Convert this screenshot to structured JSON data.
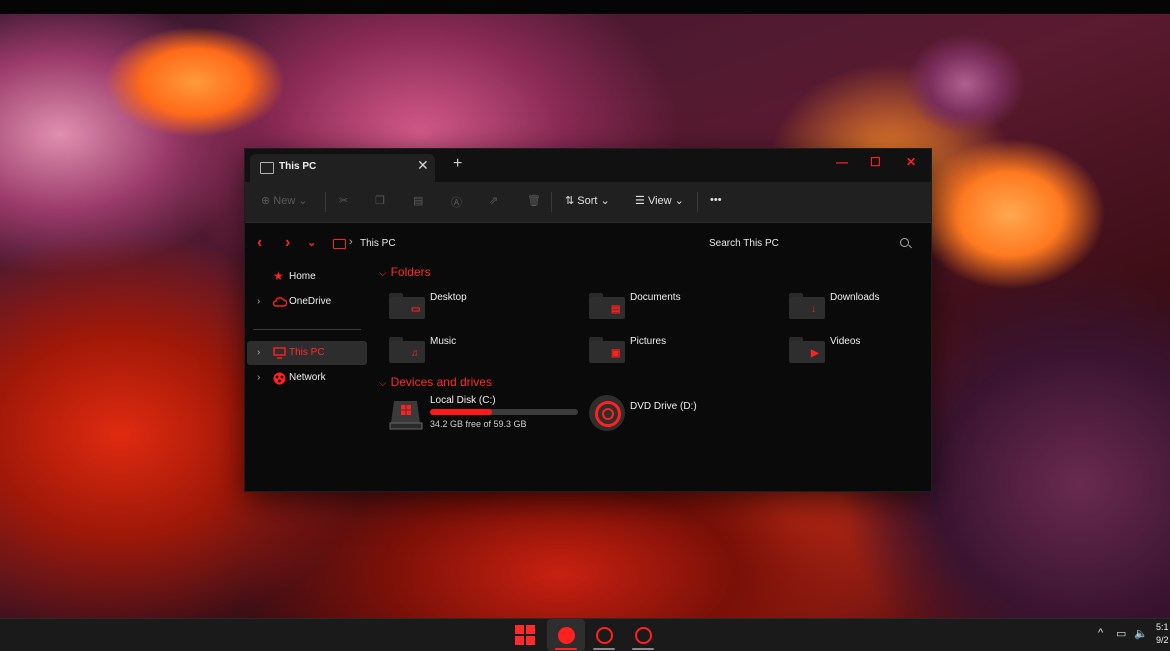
{
  "window": {
    "tab_title": "This PC",
    "tab_close": "✕",
    "new_tab": "+",
    "controls": {
      "minimize": "—",
      "maximize": "☐",
      "close": "✕"
    }
  },
  "toolbar": {
    "new_label": "New",
    "sort_label": "Sort",
    "view_label": "View",
    "more_label": "•••"
  },
  "address": {
    "back": "‹",
    "forward": "›",
    "recent": "⌄",
    "separator": "›",
    "breadcrumb": "This PC",
    "search_placeholder": "Search This PC"
  },
  "sidebar": {
    "items": [
      {
        "label": "Home",
        "icon": "home-star-icon"
      },
      {
        "label": "OneDrive",
        "icon": "cloud-icon"
      },
      {
        "label": "This PC",
        "icon": "monitor-icon",
        "selected": true
      },
      {
        "label": "Network",
        "icon": "network-icon"
      }
    ]
  },
  "content": {
    "folders_header": "Folders",
    "folders": [
      {
        "label": "Desktop",
        "glyph": "▭"
      },
      {
        "label": "Documents",
        "glyph": "▤"
      },
      {
        "label": "Downloads",
        "glyph": "↓"
      },
      {
        "label": "Music",
        "glyph": "♫"
      },
      {
        "label": "Pictures",
        "glyph": "▣"
      },
      {
        "label": "Videos",
        "glyph": "▶"
      }
    ],
    "drives_header": "Devices and drives",
    "drives": [
      {
        "name": "Local Disk (C:)",
        "free_text": "34.2 GB free of 59.3 GB",
        "used_fraction": 0.42
      },
      {
        "name": "DVD Drive (D:)"
      }
    ]
  },
  "taskbar": {
    "tray_chevron": "^",
    "clock_time": "5:1",
    "clock_date": "9/2"
  },
  "colors": {
    "accent": "#ff2020",
    "window_bg": "#0a0a0a",
    "toolbar_bg": "#202020"
  }
}
